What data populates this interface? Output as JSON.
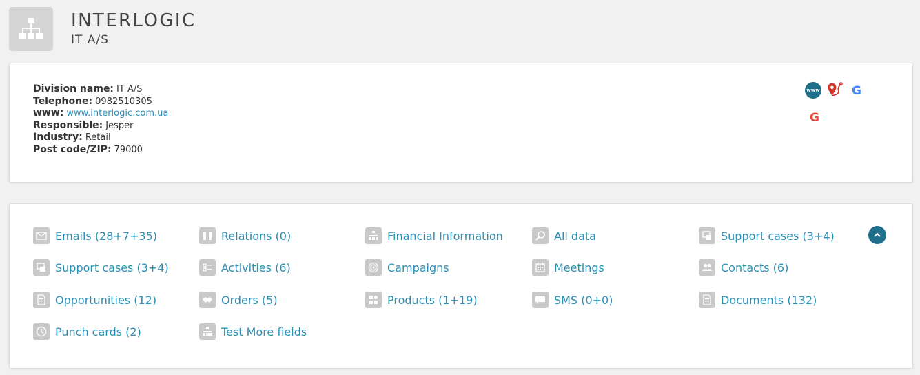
{
  "header": {
    "icon": "org-chart-icon",
    "company_name": "INTERLOGIC",
    "company_subtitle": "IT A/S"
  },
  "info": {
    "division_label": "Division name:",
    "division_value": "IT A/S",
    "telephone_label": "Telephone:",
    "telephone_value": "0982510305",
    "www_label": "www:",
    "www_value": "www.interlogic.com.ua",
    "responsible_label": "Responsible:",
    "responsible_value": "Jesper",
    "industry_label": "Industry:",
    "industry_value": "Retail",
    "postcode_label": "Post code/ZIP:",
    "postcode_value": "79000"
  },
  "external_links": {
    "www_badge": "www",
    "google_letter": "G"
  },
  "links": {
    "emails": "Emails (28+7+35)",
    "relations": "Relations (0)",
    "financial_information": "Financial Information",
    "all_data": "All data",
    "support_cases_top": "Support cases (3+4)",
    "support_cases": "Support cases (3+4)",
    "activities": "Activities (6)",
    "campaigns": "Campaigns",
    "meetings": "Meetings",
    "contacts": "Contacts (6)",
    "opportunities": "Opportunities (12)",
    "orders": "Orders (5)",
    "products": "Products (1+19)",
    "sms": "SMS (0+0)",
    "documents": "Documents (132)",
    "punch_cards": "Punch cards (2)",
    "test_more_fields": "Test More fields"
  },
  "colors": {
    "link": "#2a8fb5",
    "accent_dark": "#1d6f8c",
    "icon_bg": "#c9c9c9",
    "map_pin": "#d0342c"
  }
}
